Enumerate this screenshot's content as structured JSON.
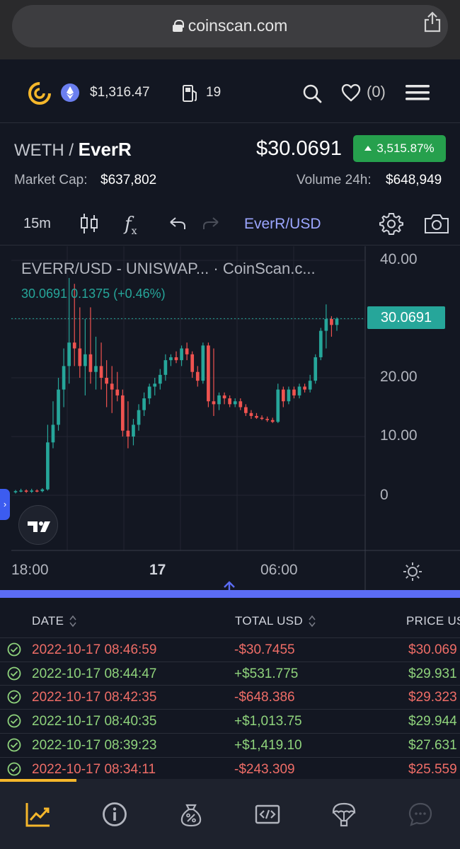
{
  "browser": {
    "url": "coinscan.com"
  },
  "topnav": {
    "eth_price": "$1,316.47",
    "gas_value": "19",
    "favorites_count": "(0)"
  },
  "pair": {
    "base": "WETH /",
    "quote": "EverR",
    "price": "$30.0691",
    "change": "3,515.87%",
    "market_cap_label": "Market Cap:",
    "market_cap_value": "$637,802",
    "volume_label": "Volume 24h:",
    "volume_value": "$648,949"
  },
  "toolbar": {
    "interval": "15m",
    "symbol": "EverR/USD",
    "fx": "f",
    "fx_sub": "x"
  },
  "chart": {
    "legend_title": "EVERR/USD - UNISWAP... · CoinScan.c...",
    "legend_values": "30.0691  0.1375 (+0.46%)",
    "last_price_tag": "30.0691",
    "colors": {
      "up": "#26a69a",
      "down": "#ef5350",
      "background": "#131722",
      "accent": "#5b6cf5"
    }
  },
  "chart_data": {
    "type": "candlestick",
    "title": "EVERR/USD - UNISWAP... · CoinScan.c...",
    "ylim": [
      -5,
      42
    ],
    "y_ticks": [
      "40.00",
      "20.00",
      "10.00",
      "0"
    ],
    "x_ticks": [
      "18:00",
      "17",
      "06:00"
    ],
    "last_price": 30.0691,
    "change": 0.1375,
    "change_pct": "+0.46%",
    "candles": [
      {
        "o": 0.5,
        "h": 0.9,
        "l": 0.3,
        "c": 0.7
      },
      {
        "o": 0.7,
        "h": 1.1,
        "l": 0.5,
        "c": 0.8
      },
      {
        "o": 0.8,
        "h": 1.0,
        "l": 0.4,
        "c": 0.6
      },
      {
        "o": 0.6,
        "h": 1.1,
        "l": 0.4,
        "c": 0.8
      },
      {
        "o": 0.8,
        "h": 1.0,
        "l": 0.5,
        "c": 0.7
      },
      {
        "o": 0.7,
        "h": 1.2,
        "l": 0.5,
        "c": 1.0
      },
      {
        "o": 1.0,
        "h": 12.0,
        "l": 0.8,
        "c": 9.0
      },
      {
        "o": 9.0,
        "h": 16.0,
        "l": 8.0,
        "c": 12.0
      },
      {
        "o": 12.0,
        "h": 20.0,
        "l": 11.0,
        "c": 18.0
      },
      {
        "o": 18.0,
        "h": 25.0,
        "l": 15.0,
        "c": 22.0
      },
      {
        "o": 22.0,
        "h": 37.0,
        "l": 19.0,
        "c": 26.0
      },
      {
        "o": 26.0,
        "h": 36.0,
        "l": 22.0,
        "c": 25.0
      },
      {
        "o": 25.0,
        "h": 32.0,
        "l": 20.0,
        "c": 22.0
      },
      {
        "o": 22.0,
        "h": 30.0,
        "l": 17.0,
        "c": 24.0
      },
      {
        "o": 24.0,
        "h": 32.0,
        "l": 19.0,
        "c": 21.0
      },
      {
        "o": 21.0,
        "h": 27.0,
        "l": 18.0,
        "c": 22.0
      },
      {
        "o": 22.0,
        "h": 26.0,
        "l": 18.0,
        "c": 20.0
      },
      {
        "o": 20.0,
        "h": 23.0,
        "l": 15.0,
        "c": 19.0
      },
      {
        "o": 19.0,
        "h": 22.0,
        "l": 14.0,
        "c": 18.0
      },
      {
        "o": 18.0,
        "h": 21.0,
        "l": 16.0,
        "c": 17.0
      },
      {
        "o": 17.0,
        "h": 18.0,
        "l": 10.0,
        "c": 11.0
      },
      {
        "o": 11.0,
        "h": 16.0,
        "l": 8.0,
        "c": 10.0
      },
      {
        "o": 10.0,
        "h": 13.0,
        "l": 8.5,
        "c": 12.0
      },
      {
        "o": 12.0,
        "h": 15.5,
        "l": 11.0,
        "c": 14.5
      },
      {
        "o": 14.5,
        "h": 17.5,
        "l": 13.5,
        "c": 16.5
      },
      {
        "o": 16.5,
        "h": 19.0,
        "l": 15.5,
        "c": 18.5
      },
      {
        "o": 18.5,
        "h": 20.0,
        "l": 17.0,
        "c": 19.0
      },
      {
        "o": 19.0,
        "h": 21.5,
        "l": 18.0,
        "c": 20.5
      },
      {
        "o": 20.5,
        "h": 24.0,
        "l": 19.5,
        "c": 23.0
      },
      {
        "o": 23.0,
        "h": 24.0,
        "l": 22.0,
        "c": 23.5
      },
      {
        "o": 23.5,
        "h": 24.5,
        "l": 22.5,
        "c": 23.0
      },
      {
        "o": 23.0,
        "h": 25.5,
        "l": 22.0,
        "c": 25.0
      },
      {
        "o": 25.0,
        "h": 26.0,
        "l": 23.0,
        "c": 24.0
      },
      {
        "o": 24.0,
        "h": 24.5,
        "l": 20.0,
        "c": 21.0
      },
      {
        "o": 21.0,
        "h": 22.0,
        "l": 18.5,
        "c": 19.5
      },
      {
        "o": 19.5,
        "h": 26.0,
        "l": 19.0,
        "c": 25.5
      },
      {
        "o": 25.5,
        "h": 26.0,
        "l": 15.0,
        "c": 16.0
      },
      {
        "o": 16.0,
        "h": 25.0,
        "l": 13.5,
        "c": 15.5
      },
      {
        "o": 15.5,
        "h": 17.5,
        "l": 14.5,
        "c": 17.0
      },
      {
        "o": 17.0,
        "h": 17.5,
        "l": 15.5,
        "c": 16.5
      },
      {
        "o": 16.5,
        "h": 17.0,
        "l": 15.0,
        "c": 15.5
      },
      {
        "o": 15.5,
        "h": 16.5,
        "l": 15.0,
        "c": 16.0
      },
      {
        "o": 16.0,
        "h": 16.5,
        "l": 14.5,
        "c": 15.0
      },
      {
        "o": 15.0,
        "h": 15.5,
        "l": 13.5,
        "c": 14.0
      },
      {
        "o": 14.0,
        "h": 14.5,
        "l": 13.0,
        "c": 13.5
      },
      {
        "o": 13.5,
        "h": 14.0,
        "l": 13.0,
        "c": 13.2
      },
      {
        "o": 13.2,
        "h": 13.6,
        "l": 12.8,
        "c": 13.0
      },
      {
        "o": 13.0,
        "h": 13.4,
        "l": 12.5,
        "c": 12.8
      },
      {
        "o": 12.8,
        "h": 13.2,
        "l": 12.3,
        "c": 12.5
      },
      {
        "o": 12.5,
        "h": 19.0,
        "l": 12.3,
        "c": 18.0
      },
      {
        "o": 18.0,
        "h": 18.5,
        "l": 15.0,
        "c": 16.0
      },
      {
        "o": 16.0,
        "h": 18.5,
        "l": 15.5,
        "c": 18.0
      },
      {
        "o": 18.0,
        "h": 18.5,
        "l": 16.5,
        "c": 17.0
      },
      {
        "o": 17.0,
        "h": 19.0,
        "l": 16.5,
        "c": 18.5
      },
      {
        "o": 18.5,
        "h": 19.0,
        "l": 17.5,
        "c": 18.0
      },
      {
        "o": 18.0,
        "h": 20.5,
        "l": 17.5,
        "c": 19.5
      },
      {
        "o": 19.5,
        "h": 24.0,
        "l": 19.0,
        "c": 23.5
      },
      {
        "o": 23.5,
        "h": 28.5,
        "l": 23.0,
        "c": 28.0
      },
      {
        "o": 28.0,
        "h": 32.5,
        "l": 25.0,
        "c": 30.0
      },
      {
        "o": 30.0,
        "h": 30.5,
        "l": 27.0,
        "c": 29.0
      },
      {
        "o": 29.0,
        "h": 30.3,
        "l": 28.0,
        "c": 30.0691
      }
    ]
  },
  "table": {
    "headers": [
      "DATE",
      "TOTAL USD",
      "PRICE US"
    ],
    "rows": [
      {
        "date": "2022-10-17 08:46:59",
        "total": "-$30.7455",
        "price": "$30.069",
        "side": "sell"
      },
      {
        "date": "2022-10-17 08:44:47",
        "total": "+$531.775",
        "price": "$29.931",
        "side": "buy"
      },
      {
        "date": "2022-10-17 08:42:35",
        "total": "-$648.386",
        "price": "$29.323",
        "side": "sell"
      },
      {
        "date": "2022-10-17 08:40:35",
        "total": "+$1,013.75",
        "price": "$29.944",
        "side": "buy"
      },
      {
        "date": "2022-10-17 08:39:23",
        "total": "+$1,419.10",
        "price": "$27.631",
        "side": "buy"
      },
      {
        "date": "2022-10-17 08:34:11",
        "total": "-$243.309",
        "price": "$25.559",
        "side": "sell"
      }
    ]
  },
  "tabbar": {
    "tabs": [
      "chart-icon",
      "info-icon",
      "money-bag-icon",
      "code-icon",
      "airdrop-icon",
      "chat-icon"
    ],
    "active": "chart-icon",
    "accent": "#f5b72b"
  }
}
